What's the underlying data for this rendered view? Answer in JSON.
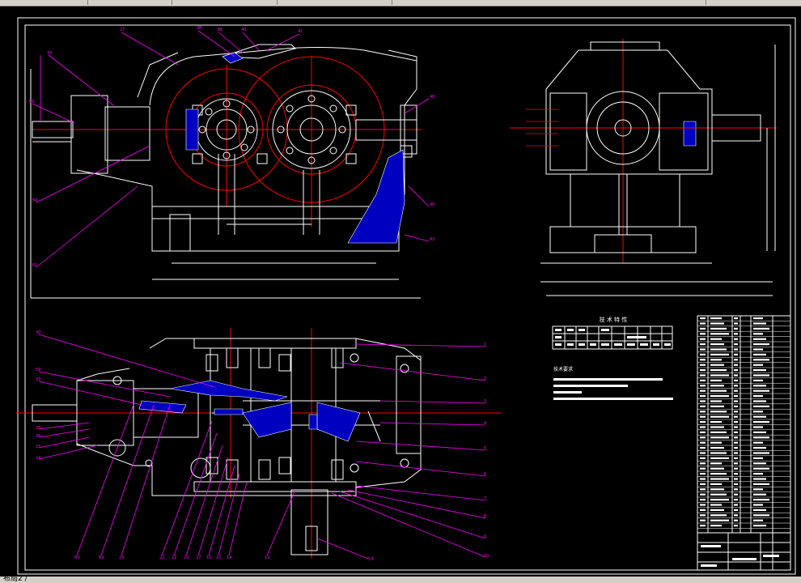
{
  "status": {
    "text": "布局2 /"
  },
  "drawing": {
    "tech_table": {
      "title": "技 术 特 性"
    },
    "notes": {
      "title": "技术要求"
    }
  },
  "colors": {
    "background": "#000000",
    "outline": "#ffffff",
    "leader": "#ff00ff",
    "center": "#ff0000",
    "section": "#0000ff"
  }
}
